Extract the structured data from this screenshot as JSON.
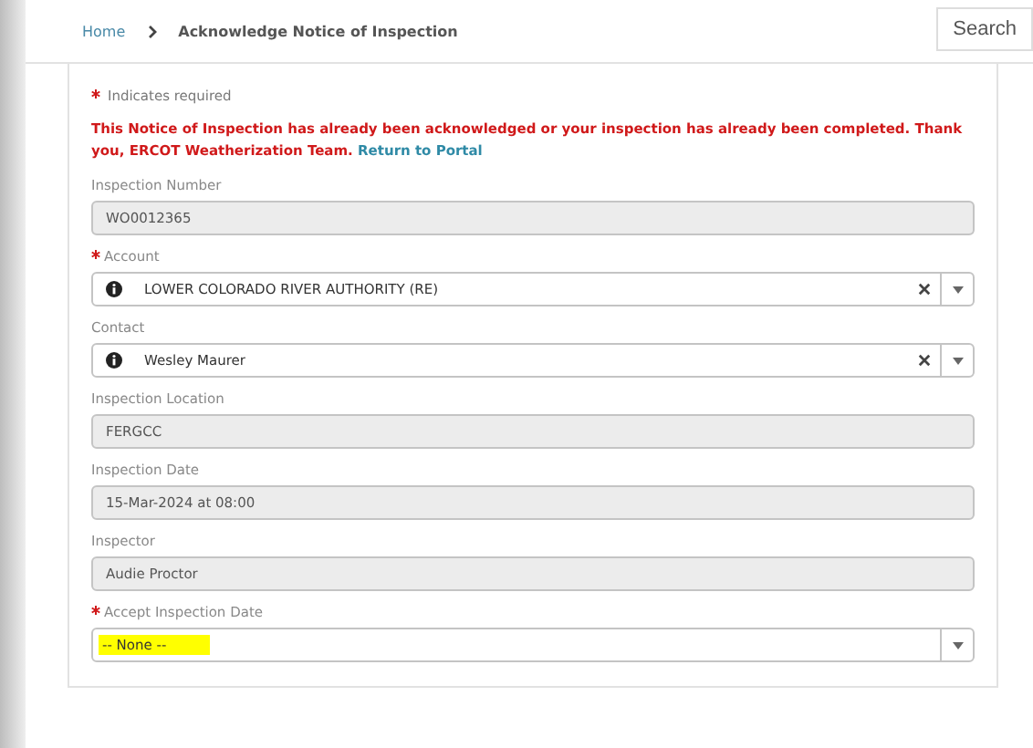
{
  "breadcrumb": [
    {
      "label": "Home",
      "link": true
    },
    {
      "label": "Acknowledge Notice of Inspection",
      "link": false
    }
  ],
  "search_button": "Search",
  "required_note": "Indicates required",
  "notice": {
    "text": "This Notice of Inspection has already been acknowledged or your inspection has already been completed. Thank you, ERCOT Weatherization Team.",
    "link": "Return to Portal"
  },
  "fields": [
    {
      "kind": "readonly",
      "label": "Inspection Number",
      "required": false,
      "value": "WO0012365"
    },
    {
      "kind": "lookup",
      "label": "Account",
      "required": true,
      "value": "LOWER COLORADO RIVER AUTHORITY (RE)"
    },
    {
      "kind": "lookup",
      "label": "Contact",
      "required": false,
      "value": "Wesley Maurer"
    },
    {
      "kind": "readonly",
      "label": "Inspection Location",
      "required": false,
      "value": "FERGCC"
    },
    {
      "kind": "readonly",
      "label": "Inspection Date",
      "required": false,
      "value": "15-Mar-2024 at 08:00"
    },
    {
      "kind": "readonly",
      "label": "Inspector",
      "required": false,
      "value": "Audie Proctor"
    },
    {
      "kind": "picklist",
      "label": "Accept Inspection Date",
      "required": true,
      "value": "-- None --",
      "highlighted": true
    }
  ]
}
